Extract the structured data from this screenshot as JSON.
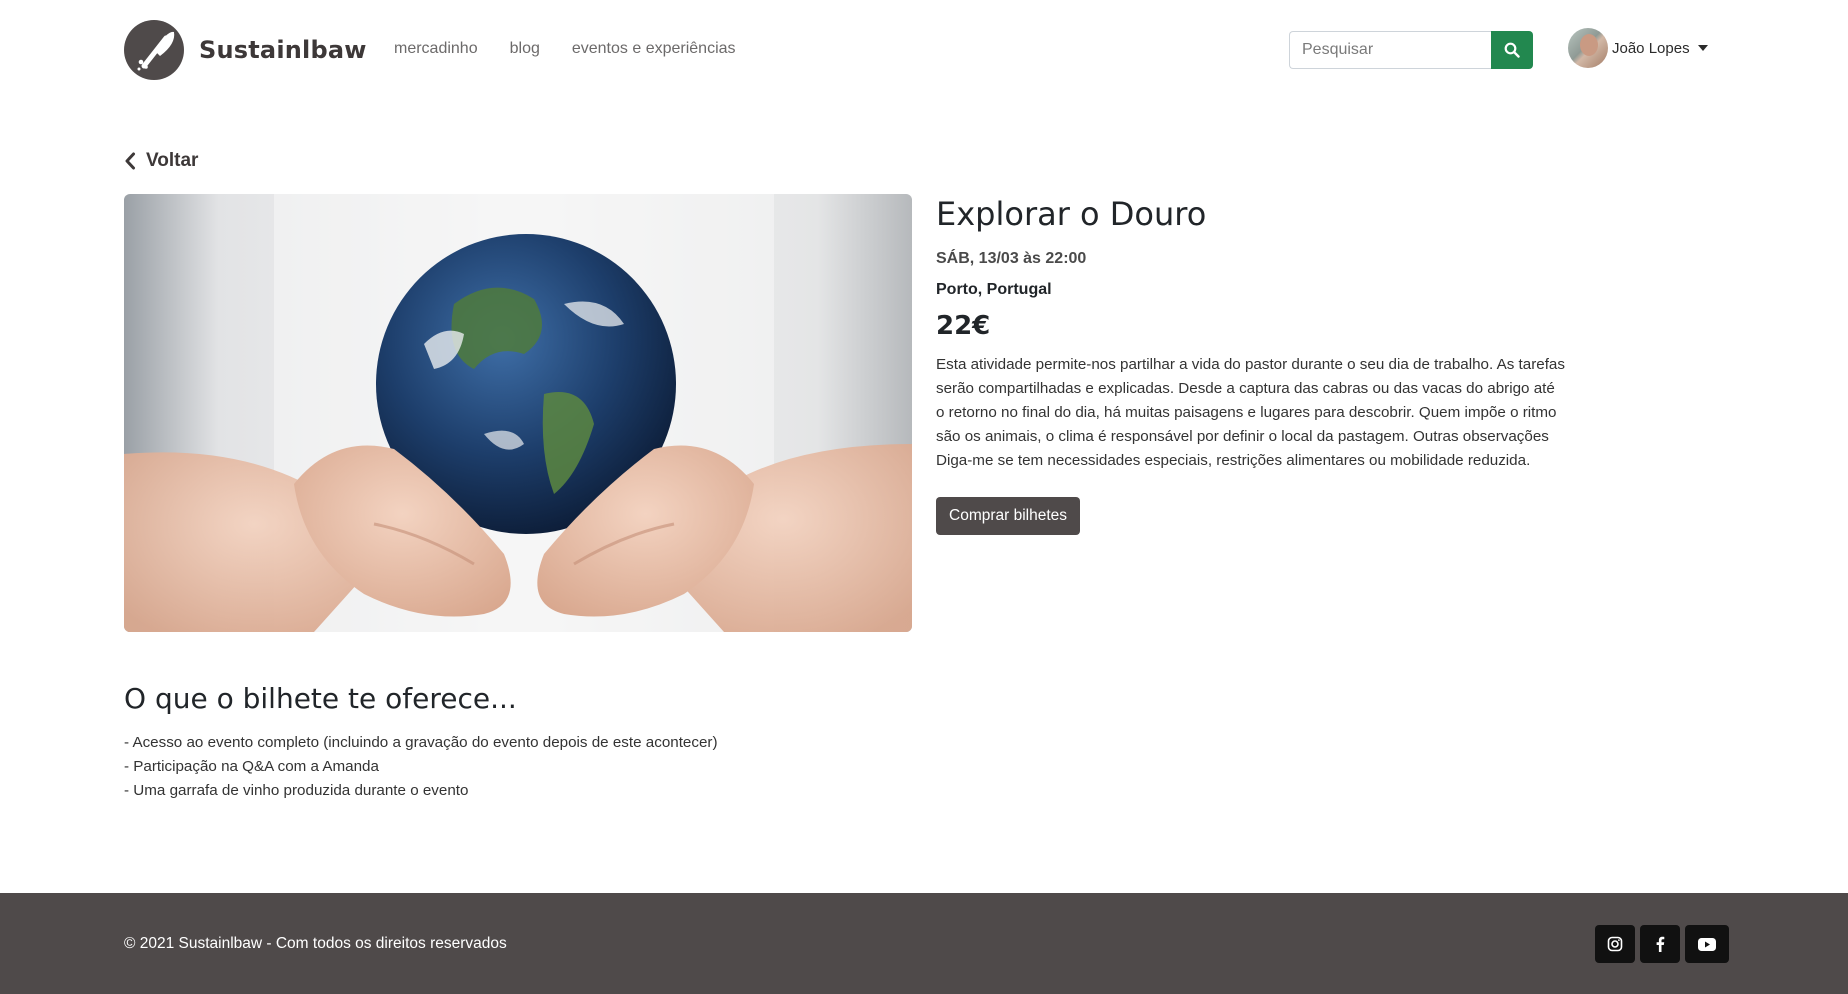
{
  "brand": {
    "name": "Sustainlbaw",
    "logo_icon": "leaf-logo-icon"
  },
  "nav": {
    "links": [
      {
        "label": "mercadinho"
      },
      {
        "label": "blog"
      },
      {
        "label": "eventos e experiências"
      }
    ]
  },
  "search": {
    "placeholder": "Pesquisar",
    "value": "",
    "button_icon": "search-icon",
    "button_color": "#22884f"
  },
  "user": {
    "name": "João Lopes",
    "avatar_icon": "avatar"
  },
  "back": {
    "label": "Voltar"
  },
  "event": {
    "image_alt": "Mãos segurando o planeta Terra",
    "title": "Explorar o Douro",
    "date": "SÁB, 13/03 às 22:00",
    "location": "Porto, Portugal",
    "price": "22€",
    "description": "Esta atividade permite-nos partilhar a vida do pastor durante o seu dia de trabalho. As tarefas serão compartilhadas e explicadas. Desde a captura das cabras ou das vacas do abrigo até o retorno no final do dia, há muitas paisagens e lugares para descobrir. Quem impõe o ritmo são os animais, o clima é responsável por definir o local da pastagem. Outras observações Diga-me se tem necessidades especiais, restrições alimentares ou mobilidade reduzida.",
    "buy_label": "Comprar bilhetes"
  },
  "offers": {
    "title": "O que o bilhete te oferece...",
    "items": [
      "- Acesso ao evento completo (incluindo a gravação do evento depois de este acontecer)",
      "- Participação na Q&A com a Amanda",
      "- Uma garrafa de vinho produzida durante o evento"
    ]
  },
  "footer": {
    "copyright": "© 2021 Sustainlbaw - Com todos os direitos reservados",
    "social": [
      {
        "icon": "instagram-icon"
      },
      {
        "icon": "facebook-icon"
      },
      {
        "icon": "youtube-icon"
      }
    ],
    "background_color": "#4f4a4a"
  },
  "colors": {
    "primary_dark": "#4f4a4a",
    "accent_green": "#22884f"
  }
}
